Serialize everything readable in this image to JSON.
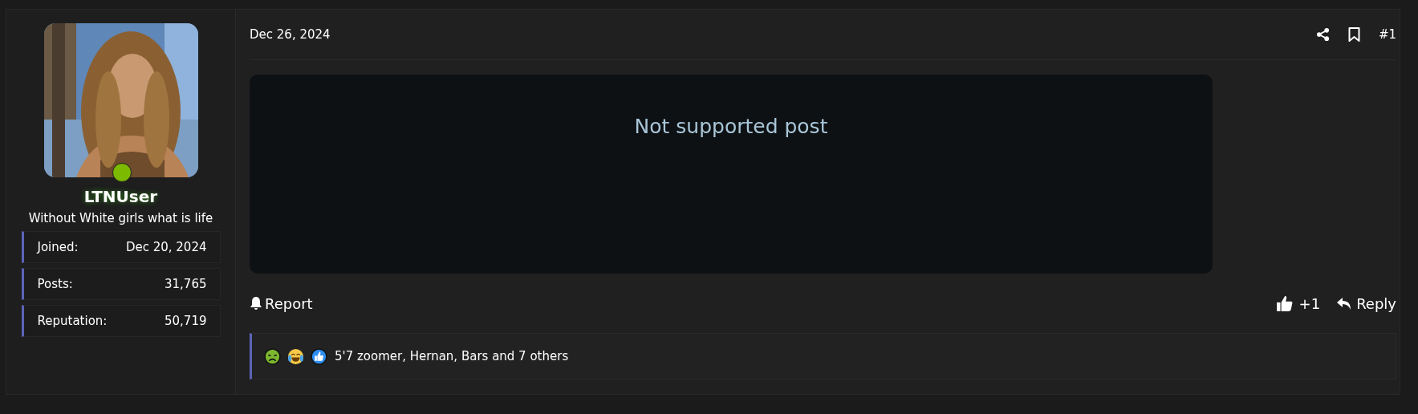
{
  "user": {
    "name": "LTNUser",
    "tagline": "Without White girls what is life",
    "online": true,
    "stats": [
      {
        "label": "Joined:",
        "value": "Dec 20, 2024"
      },
      {
        "label": "Posts:",
        "value": "31,765"
      },
      {
        "label": "Reputation:",
        "value": "50,719"
      }
    ]
  },
  "post": {
    "date": "Dec 26, 2024",
    "number": "#1",
    "content": "Not supported post",
    "report": "Report",
    "likes": "+1",
    "reply": "Reply",
    "reactions": "5'7 zoomer, Hernan, Bars and 7 others"
  }
}
